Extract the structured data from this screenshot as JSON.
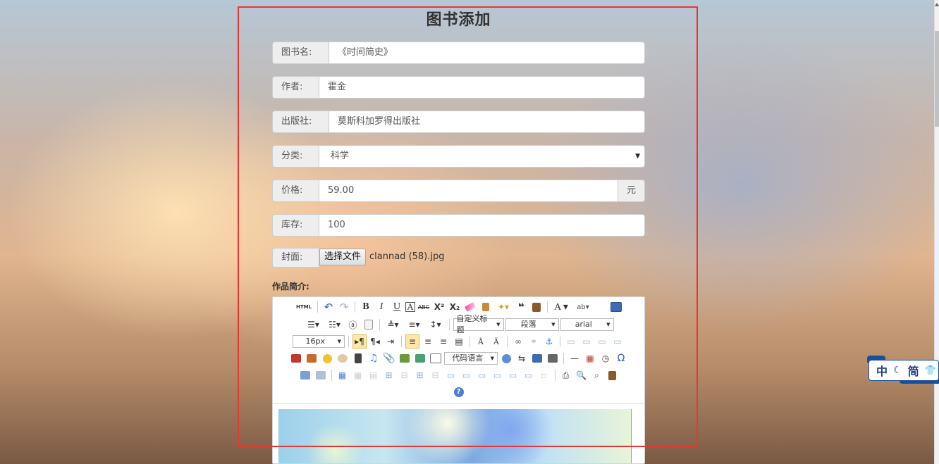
{
  "form": {
    "title": "图书添加",
    "fields": {
      "name": {
        "label": "图书名:",
        "value": "《时间简史》"
      },
      "author": {
        "label": "作者:",
        "value": "霍金"
      },
      "publisher": {
        "label": "出版社:",
        "value": "莫斯科加罗得出版社"
      },
      "category": {
        "label": "分类:",
        "value": "科学"
      },
      "price": {
        "label": "价格:",
        "value": "59.00",
        "unit": "元"
      },
      "stock": {
        "label": "库存:",
        "value": "100"
      },
      "cover": {
        "label": "封面:",
        "button": "选择文件",
        "filename": "clannad (58).jpg"
      }
    },
    "description_label": "作品简介:"
  },
  "editor": {
    "html_label": "HTML",
    "font_family_combo": "自定义标题",
    "paragraph_combo": "段落",
    "font_combo": "arial",
    "font_size_combo": "16px",
    "code_lang_combo": "代码语言",
    "icons": [
      "html-icon",
      "undo-icon",
      "redo-icon",
      "bold-icon",
      "italic-icon",
      "underline-icon",
      "font-border-icon",
      "strikethrough-icon",
      "superscript-icon",
      "subscript-icon",
      "eraser-icon",
      "format-brush-icon",
      "auto-format-icon",
      "blockquote-icon",
      "paste-plain-icon",
      "font-color-icon",
      "background-color-icon",
      "fullscreen-icon"
    ],
    "help": "?"
  },
  "ime": {
    "lang": "中",
    "moon": "☾",
    "simplified": "简",
    "shirt": "👕"
  },
  "colors": {
    "accent_border": "#e53935",
    "ime_blue": "#1a4f9c"
  }
}
